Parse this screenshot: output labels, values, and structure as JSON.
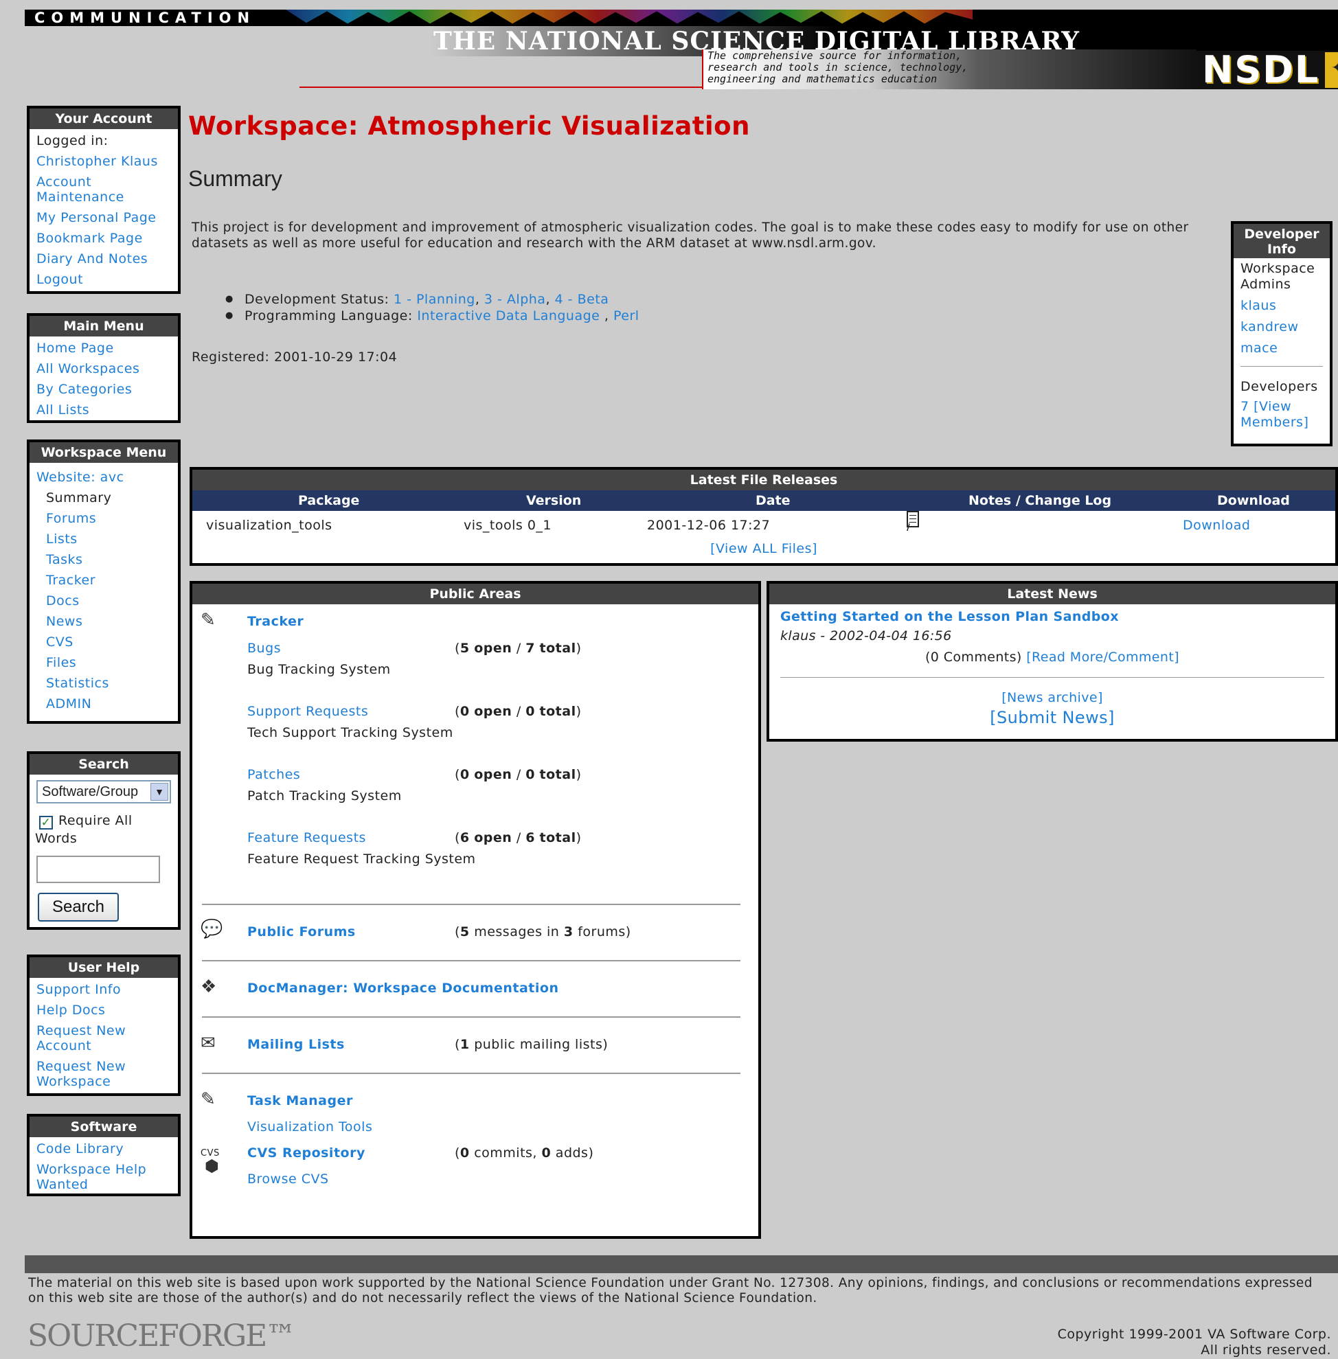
{
  "header": {
    "communication": "COMMUNICATION",
    "title": "THE NATIONAL SCIENCE DIGITAL LIBRARY",
    "tagline": "The comprehensive source for information, research and tools in science, technology, engineering and mathematics education",
    "logo_text": "NSDL"
  },
  "account": {
    "title": "Your Account",
    "logged_in": "Logged in:",
    "user": "Christopher Klaus",
    "items": [
      "Account Maintenance",
      "My Personal Page",
      "Bookmark Page",
      "Diary And Notes",
      "Logout"
    ]
  },
  "main_menu": {
    "title": "Main Menu",
    "items": [
      "Home Page",
      "All Workspaces",
      "By Categories",
      "All Lists"
    ]
  },
  "workspace_menu": {
    "title": "Workspace Menu",
    "website": "Website: avc",
    "current": "Summary",
    "items": [
      "Forums",
      "Lists",
      "Tasks",
      "Tracker",
      "Docs",
      "News",
      "CVS",
      "Files",
      "Statistics",
      "ADMIN"
    ]
  },
  "search": {
    "title": "Search",
    "select_value": "Software/Group",
    "require_all": "Require All Words",
    "input_value": "",
    "button": "Search"
  },
  "user_help": {
    "title": "User Help",
    "items": [
      "Support Info",
      "Help Docs",
      "Request New Account",
      "Request New Workspace"
    ]
  },
  "software": {
    "title": "Software",
    "items": [
      "Code Library",
      "Workspace Help Wanted"
    ]
  },
  "main": {
    "title": "Workspace: Atmospheric Visualization",
    "section": "Summary",
    "description": "This project is for development and improvement of atmospheric visualization codes. The goal is to make these codes easy to modify for use on other datasets as well as more useful for education and research with the ARM dataset at www.nsdl.arm.gov.",
    "dev_status_label": "Development Status: ",
    "dev_status_links": [
      "1 - Planning",
      "3 - Alpha",
      "4 - Beta"
    ],
    "language_label": "Programming Language: ",
    "language_links": [
      "Interactive Data Language",
      "Perl"
    ],
    "registered": "Registered: 2001-10-29 17:04"
  },
  "developer_info": {
    "title": "Developer Info",
    "admins_label": "Workspace Admins",
    "admins": [
      "klaus",
      "kandrew",
      "mace"
    ],
    "developers_label": "Developers",
    "developers_count": "7",
    "view_members": "[View Members]"
  },
  "file_releases": {
    "title": "Latest File Releases",
    "columns": [
      "Package",
      "Version",
      "Date",
      "Notes / Change Log",
      "Download"
    ],
    "rows": [
      {
        "package": "visualization_tools",
        "version": "vis_tools 0_1",
        "date": "2001-12-06 17:27",
        "notes_sep": "/",
        "download": "Download"
      }
    ],
    "view_all": "[View ALL Files]"
  },
  "public_areas": {
    "title": "Public Areas",
    "tracker": {
      "label": "Tracker",
      "items": [
        {
          "name": "Bugs",
          "desc": "Bug Tracking System",
          "open": "5",
          "total": "7"
        },
        {
          "name": "Support Requests",
          "desc": "Tech Support Tracking System",
          "open": "0",
          "total": "0"
        },
        {
          "name": "Patches",
          "desc": "Patch Tracking System",
          "open": "0",
          "total": "0"
        },
        {
          "name": "Feature Requests",
          "desc": "Feature Request Tracking System",
          "open": "6",
          "total": "6"
        }
      ],
      "open_word": "open",
      "total_word": "total"
    },
    "forums": {
      "label": "Public Forums",
      "messages": "5",
      "forums": "3",
      "messages_word": "messages in",
      "forums_word": "forums"
    },
    "docs": {
      "label": "DocManager: Workspace Documentation"
    },
    "mailing": {
      "label": "Mailing Lists",
      "count": "1",
      "suffix": "public mailing lists"
    },
    "tasks": {
      "label": "Task Manager",
      "item": "Visualization Tools"
    },
    "cvs": {
      "label": "CVS Repository",
      "commits": "0",
      "adds": "0",
      "commits_word": "commits,",
      "adds_word": "adds",
      "browse": "Browse CVS",
      "icon_text": "CVS"
    }
  },
  "news": {
    "title": "Latest News",
    "headline": "Getting Started on the Lesson Plan Sandbox",
    "byline": "klaus - 2002-04-04 16:56",
    "comments": "(0 Comments)",
    "read_more": "[Read More/Comment]",
    "archive": "[News archive]",
    "submit": "[Submit News]"
  },
  "footer": {
    "note": "The material on this web site is based upon work supported by the National Science Foundation under Grant No. 127308. Any opinions, findings, and conclusions or recommendations expressed on this web site are those of the author(s) and do not necessarily reflect the views of the National Science Foundation.",
    "logo": "SOURCEFORGE™",
    "copyright_1": "Copyright 1999-2001 VA Software Corp.",
    "copyright_2": "All rights reserved."
  },
  "colors": {
    "title_red": "#cc0000",
    "link_blue": "#1f7fd6",
    "box_header": "#444444",
    "table_header": "#243763",
    "page_bg": "#cccccc"
  }
}
